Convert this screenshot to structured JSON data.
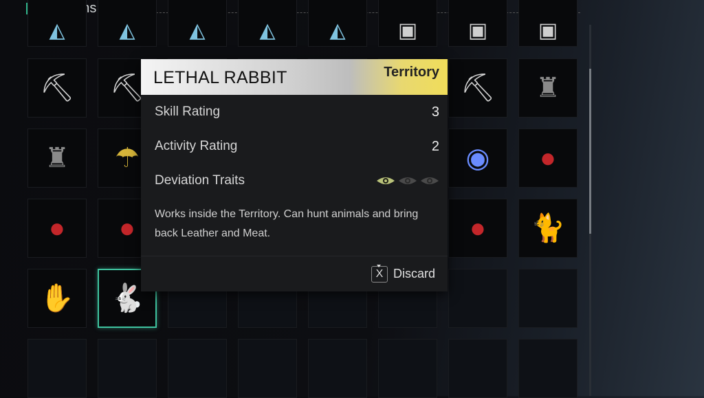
{
  "header": {
    "title": "Deviations"
  },
  "accent_color": "#3fc4a0",
  "grid": {
    "rows": [
      [
        "terrain-icon",
        "terrain-icon",
        "terrain-icon",
        "terrain-icon",
        "terrain-icon",
        "robot-icon",
        "robot-icon",
        "robot-icon"
      ],
      [
        "robot-pickaxe-icon",
        "robot-pickaxe-icon",
        "",
        "",
        "",
        "",
        "robot-pickaxe-icon",
        "samurai-icon"
      ],
      [
        "samurai-icon",
        "raincoat-icon",
        "",
        "",
        "",
        "",
        "energy-orb-icon",
        "red-mask-doll-icon"
      ],
      [
        "red-mask-doll-icon",
        "red-mask-doll-icon",
        "",
        "",
        "",
        "",
        "red-mask-doll-icon",
        "striped-cat-icon"
      ],
      [
        "mechanical-hand-icon",
        "lethal-rabbit-icon",
        "",
        "",
        "",
        "",
        "",
        ""
      ],
      [
        "",
        "",
        "",
        "",
        "",
        "",
        "",
        ""
      ]
    ],
    "selected": {
      "row": 4,
      "col": 1
    }
  },
  "tooltip": {
    "name": "LETHAL RABBIT",
    "category": "Territory",
    "stats": [
      {
        "label": "Skill Rating",
        "value": "3"
      },
      {
        "label": "Activity Rating",
        "value": "2"
      }
    ],
    "traits_label": "Deviation Traits",
    "traits": {
      "active": 1,
      "total": 3
    },
    "description": "Works inside the Territory. Can hunt animals and bring back Leather and Meat.",
    "action": {
      "key": "X",
      "label": "Discard"
    }
  }
}
